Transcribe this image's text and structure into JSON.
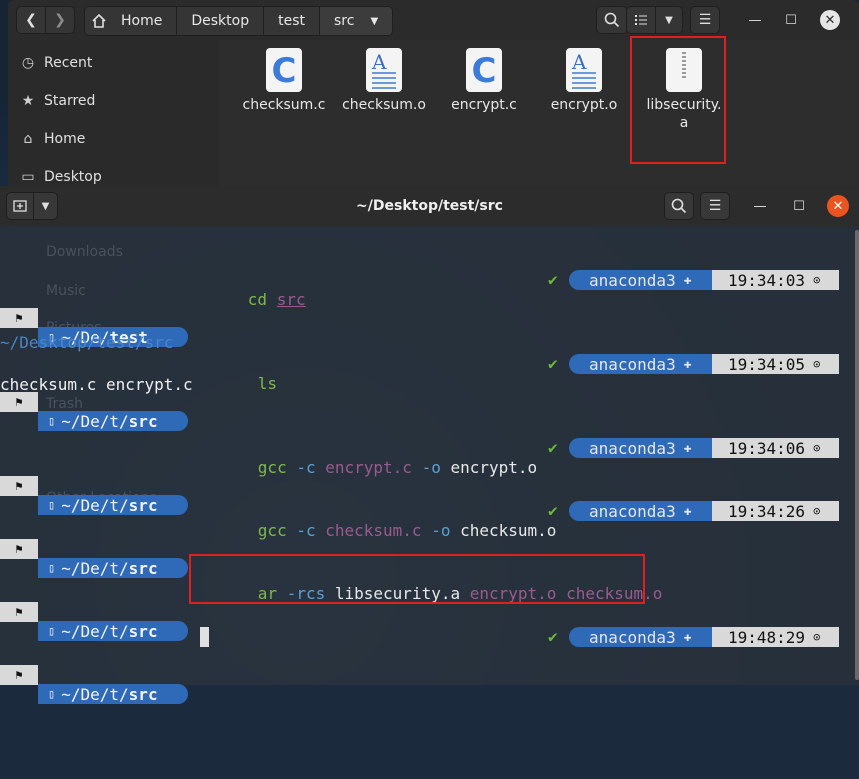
{
  "file_manager": {
    "path": [
      "Home",
      "Desktop",
      "test",
      "src"
    ],
    "sidebar": [
      {
        "label": "Recent",
        "icon": "clock-icon"
      },
      {
        "label": "Starred",
        "icon": "star-icon"
      },
      {
        "label": "Home",
        "icon": "home-icon"
      },
      {
        "label": "Desktop",
        "icon": "desktop-icon"
      }
    ],
    "files": [
      {
        "label": "checksum.c",
        "icon": "c-source-icon"
      },
      {
        "label": "checksum.o",
        "icon": "document-icon"
      },
      {
        "label": "encrypt.c",
        "icon": "c-source-icon"
      },
      {
        "label": "encrypt.o",
        "icon": "document-icon"
      },
      {
        "label": "libsecurity.\na",
        "icon": "archive-icon"
      }
    ]
  },
  "terminal": {
    "title": "~/Desktop/test/src",
    "ghost_sidebar": [
      "Downloads",
      "Music",
      "Pictures",
      "Trash",
      "Other Locations"
    ],
    "env": "anaconda3",
    "lines": [
      {
        "path_prefix": "~/De/",
        "path_bold": "test",
        "cmd": [
          {
            "t": "cd ",
            "c": "green"
          },
          {
            "t": "src",
            "c": "purple-u"
          }
        ],
        "time": "19:34:03"
      },
      {
        "pwd": "~/Desktop/test/src"
      },
      {
        "path_prefix": "~/De/t/",
        "path_bold": "src",
        "cmd": [
          {
            "t": "ls",
            "c": "green"
          }
        ],
        "time": "19:34:05"
      },
      {
        "output": "checksum.c  encrypt.c"
      },
      {
        "path_prefix": "~/De/t/",
        "path_bold": "src",
        "cmd": [
          {
            "t": "gcc ",
            "c": "green"
          },
          {
            "t": "-c ",
            "c": "cyan"
          },
          {
            "t": "encrypt.c ",
            "c": "purple"
          },
          {
            "t": "-o ",
            "c": "cyan"
          },
          {
            "t": "encrypt.o",
            "c": "white"
          }
        ],
        "time": "19:34:06"
      },
      {
        "path_prefix": "~/De/t/",
        "path_bold": "src",
        "cmd": [
          {
            "t": "gcc ",
            "c": "green"
          },
          {
            "t": "-c ",
            "c": "cyan"
          },
          {
            "t": "checksum.c ",
            "c": "purple"
          },
          {
            "t": "-o ",
            "c": "cyan"
          },
          {
            "t": "checksum.o",
            "c": "white"
          }
        ],
        "time": "19:34:26"
      },
      {
        "path_prefix": "~/De/t/",
        "path_bold": "src",
        "cmd": [
          {
            "t": "ar ",
            "c": "green"
          },
          {
            "t": "-rcs ",
            "c": "cyan"
          },
          {
            "t": "libsecurity.a ",
            "c": "white"
          },
          {
            "t": "encrypt.o ",
            "c": "purple"
          },
          {
            "t": "checksum.o",
            "c": "purple"
          }
        ],
        "time": ""
      },
      {
        "path_prefix": "~/De/t/",
        "path_bold": "src",
        "cmd": [],
        "time": "19:48:29"
      }
    ]
  },
  "colors": {
    "highlight": "#e0201e",
    "prompt_blue": "#2f6ab8",
    "prompt_grey": "#d9d9d9"
  }
}
